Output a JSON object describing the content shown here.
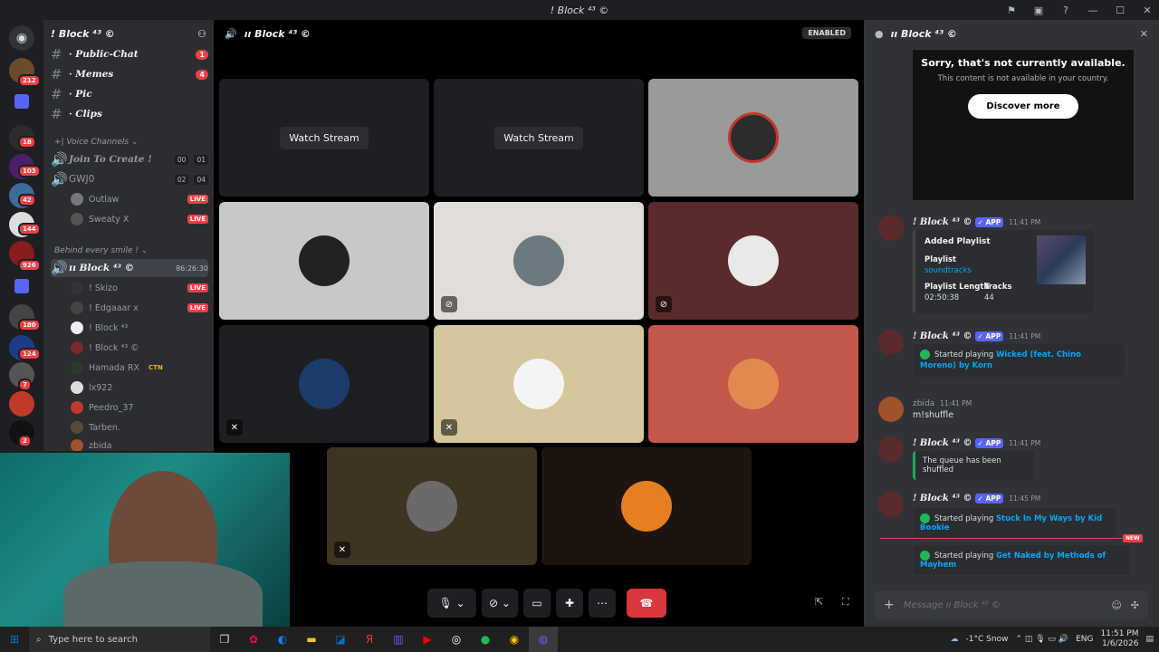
{
  "window": {
    "title": "! Block ⁴³ ©"
  },
  "rail": {
    "badges": [
      "212",
      "18",
      "103",
      "42",
      "144",
      "926",
      "180",
      "124",
      "7",
      "2"
    ]
  },
  "sidebar": {
    "server_name": "! Block ⁴³ ©",
    "text_channels": [
      {
        "name": "· Public-Chat",
        "badge": "1"
      },
      {
        "name": "· Memes",
        "badge": "4"
      },
      {
        "name": "· Pic",
        "badge": ""
      },
      {
        "name": "· Clips",
        "badge": ""
      }
    ],
    "voice_category": "Voice Channels",
    "join_to_create": {
      "name": "Join To Create !",
      "c1": "00",
      "c2": "01"
    },
    "gwjo": {
      "name": "GWJ0",
      "c1": "02",
      "c2": "04"
    },
    "gwjo_users": [
      {
        "name": "Outlaw",
        "live": "LIVE"
      },
      {
        "name": "Sweaty X",
        "live": "LIVE"
      }
    ],
    "behind_category": "Behind every smile !",
    "active_channel": {
      "name": "ıı Block ⁴³ ©",
      "timer": "86:26:30"
    },
    "active_users": [
      {
        "name": "! Skizo",
        "live": "LIVE"
      },
      {
        "name": "! Edgaaar x",
        "live": "LIVE"
      },
      {
        "name": "! Block ⁴³",
        "live": ""
      },
      {
        "name": "! Block ⁴³ ©",
        "live": ""
      },
      {
        "name": "Hamada RX",
        "live": "CTN"
      },
      {
        "name": "lx922",
        "live": ""
      },
      {
        "name": "Peedro_37",
        "live": ""
      },
      {
        "name": "Tarben.",
        "live": ""
      },
      {
        "name": "zbida",
        "live": ""
      }
    ]
  },
  "stage": {
    "channel": "ıı Block ⁴³ ©",
    "enabled": "ENABLED",
    "watch_stream": "Watch Stream"
  },
  "chat": {
    "channel": "ıı Block ⁴³ ©",
    "sorry_title": "Sorry, that's not currently available.",
    "sorry_sub": "This content is not available in your country.",
    "discover": "Discover more",
    "bot_name": "! Block ⁴³ ©",
    "app": "✓ APP",
    "m1": {
      "time": "11:41 PM",
      "title": "Added Playlist",
      "pl_label": "Playlist",
      "pl_value": "soundtracks",
      "len_label": "Playlist Length",
      "len_value": "02:50:38",
      "tracks_label": "Tracks",
      "tracks_value": "44"
    },
    "m2": {
      "time": "11:41 PM",
      "prefix": "Started playing",
      "song": "Wicked (feat. Chino Moreno) by Korn"
    },
    "m3": {
      "user": "zbida",
      "time": "11:41 PM",
      "text": "m!shuffle"
    },
    "m4": {
      "time": "11:41 PM",
      "text": "The queue has been shuffled"
    },
    "m5": {
      "time": "11:45 PM",
      "prefix": "Started playing",
      "song": "Stuck In My Ways by Kid Bookie"
    },
    "new": "NEW",
    "m6": {
      "prefix": "Started playing",
      "song": "Get Naked by Methods of Mayhem"
    },
    "placeholder": "Message ıı Block ⁴³ ©"
  },
  "taskbar": {
    "search": "Type here to search",
    "weather": "-1°C  Snow",
    "lang": "ENG",
    "time": "11:51 PM",
    "date": "1/6/2026"
  }
}
